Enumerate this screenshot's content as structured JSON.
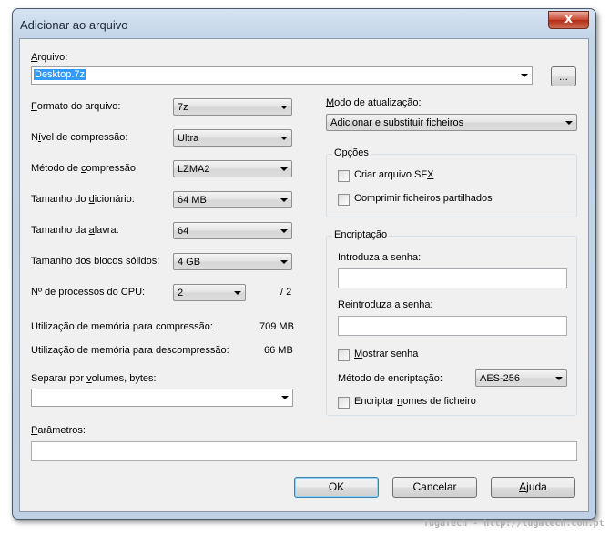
{
  "window": {
    "title": "Adicionar ao arquivo",
    "close_label": "x"
  },
  "archive": {
    "label_u": "A",
    "label_rest": "rquivo:",
    "value": "Desktop.7z",
    "browse_label": "..."
  },
  "left": {
    "format": {
      "label_u": "F",
      "label_rest": "ormato do arquivo:",
      "value": "7z"
    },
    "level": {
      "label_a": "N",
      "label_u": "í",
      "label_b": "vel de compressão:",
      "value": "Ultra"
    },
    "method": {
      "label_a": "Método de ",
      "label_u": "c",
      "label_b": "ompressão:",
      "value": "LZMA2"
    },
    "dict": {
      "label_a": "Tamanho do ",
      "label_u": "d",
      "label_b": "icionário:",
      "value": "64 MB"
    },
    "word": {
      "label_a": "Tamanho da ",
      "label_u": "a",
      "label_b": "lavra:",
      "value": "64"
    },
    "solid": {
      "label_a": "Tamanho dos blocos sólidos:",
      "value": "4 GB"
    },
    "threads": {
      "label": "Nº de processos do CPU:",
      "value": "2",
      "max": "/ 2"
    },
    "mem_comp": {
      "label": "Utilização de memória para compressão:",
      "value": "709 MB"
    },
    "mem_decomp": {
      "label": "Utilização de memória para descompressão:",
      "value": "66 MB"
    },
    "volumes": {
      "label_a": "Separar por ",
      "label_u": "v",
      "label_b": "olumes, bytes:",
      "value": ""
    },
    "params": {
      "label_a": "",
      "label_u": "P",
      "label_b": "arâmetros:",
      "value": ""
    }
  },
  "right": {
    "update": {
      "label_u": "M",
      "label_rest": "odo de atualização:",
      "value": "Adicionar e substituir ficheiros"
    },
    "options": {
      "title": "Opções",
      "sfx": {
        "label_a": "Criar arquivo SF",
        "label_u": "X",
        "label_b": ""
      },
      "shared": {
        "label": "Comprimir ficheiros partilhados"
      }
    },
    "encryption": {
      "title": "Encriptação",
      "pwd_label": "Introduza a senha:",
      "repwd_label": "Reintroduza a senha:",
      "show": {
        "label_u": "M",
        "label_rest": "ostrar senha"
      },
      "method_label": "Método de encriptação:",
      "method_value": "AES-256",
      "names": {
        "label_a": "Encriptar ",
        "label_u": "n",
        "label_b": "omes de ficheiro"
      }
    }
  },
  "buttons": {
    "ok": "OK",
    "cancel": "Cancelar",
    "help_u": "A",
    "help_rest": "juda"
  },
  "watermark": "TugaTech - http://tugatech.com.pt"
}
